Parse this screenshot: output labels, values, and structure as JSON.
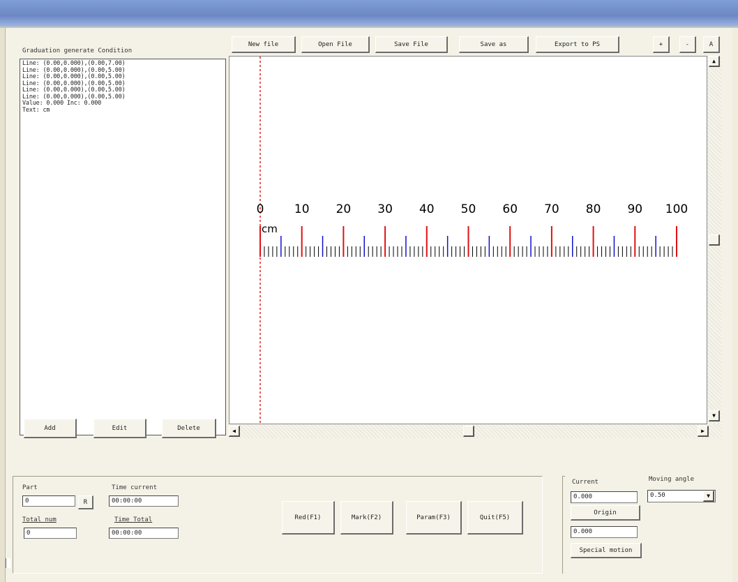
{
  "left_panel": {
    "title": "Graduation generate Condition",
    "conditions": [
      "Line: (0.00,0.000),(0.00,7.00)",
      "Line: (0.00,0.000),(0.00,5.00)",
      "Line: (0.00,0.000),(0.00,5.00)",
      "Line: (0.00,0.000),(0.00,5.00)",
      "Line: (0.00,0.000),(0.00,5.00)",
      "Line: (0.00,0.000),(0.00,5.00)",
      "Value: 0.000 Inc: 0.000",
      "Text: cm"
    ],
    "add_label": "Add",
    "edit_label": "Edit",
    "delete_label": "Delete"
  },
  "toolbar": {
    "new_label": "New file",
    "open_label": "Open File",
    "save_label": "Save File",
    "save_as_label": "Save as",
    "export_label": "Export to PS",
    "zoom_in_label": "+",
    "zoom_out_label": "-",
    "fit_label": "A"
  },
  "ruler": {
    "numbers": [
      "0",
      "10",
      "20",
      "30",
      "40",
      "50",
      "60",
      "70",
      "80",
      "90",
      "100"
    ],
    "unit": "cm",
    "major_color": "#e01010",
    "mid_color": "#1010d0",
    "minor_color": "#000000",
    "guide_color": "#e02020"
  },
  "bottom": {
    "part_label": "Part",
    "part_value": "0",
    "part_reset_label": "R",
    "total_num_label": "Total num",
    "total_num_value": "0",
    "time_current_label": "Time current",
    "time_current_value": "00:00:00",
    "time_total_label": "Time Total",
    "time_total_value": "00:00:00",
    "red_label": "Red(F1)",
    "mark_label": "Mark(F2)",
    "param_label": "Param(F3)",
    "quit_label": "Quit(F5)",
    "current_label": "Current",
    "current_value": "0.000",
    "origin_label": "Origin",
    "origin_value": "0.000",
    "special_label": "Special motion",
    "moving_angle_label": "Moving angle",
    "moving_angle_value": "0.50"
  }
}
